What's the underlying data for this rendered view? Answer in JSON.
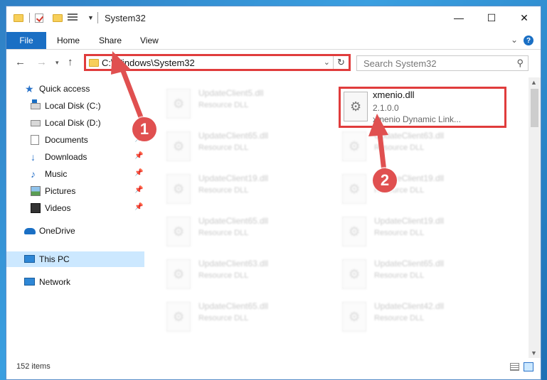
{
  "window": {
    "title": "System32",
    "controls": {
      "minimize": "—",
      "maximize": "☐",
      "close": "✕"
    }
  },
  "ribbon": {
    "tabs": [
      "File",
      "Home",
      "Share",
      "View"
    ],
    "help": "?"
  },
  "navigation": {
    "address": "C:\\Windows\\System32",
    "search_placeholder": "Search System32"
  },
  "sidebar": {
    "items": [
      {
        "label": "Quick access",
        "icon": "quick-access-icon"
      },
      {
        "label": "Local Disk (C:)",
        "icon": "local-disk-icon"
      },
      {
        "label": "Local Disk (D:)",
        "icon": "local-disk-icon"
      },
      {
        "label": "Documents",
        "icon": "documents-icon",
        "pinned": true
      },
      {
        "label": "Downloads",
        "icon": "downloads-icon",
        "pinned": true
      },
      {
        "label": "Music",
        "icon": "music-icon",
        "pinned": true
      },
      {
        "label": "Pictures",
        "icon": "pictures-icon",
        "pinned": true
      },
      {
        "label": "Videos",
        "icon": "videos-icon",
        "pinned": true
      },
      {
        "label": "OneDrive",
        "icon": "onedrive-icon"
      },
      {
        "label": "This PC",
        "icon": "this-pc-icon",
        "selected": true
      },
      {
        "label": "Network",
        "icon": "network-icon"
      }
    ]
  },
  "files": {
    "highlighted": {
      "name": "xmenio.dll",
      "version": "2.1.0.0",
      "description": "xmenio Dynamic Link..."
    },
    "blurred": [
      {
        "name": "UpdateClient5.dll",
        "type": "Resource DLL"
      },
      {
        "name": "UpdateClient65.dll",
        "type": "Resource DLL"
      },
      {
        "name": "UpdateClient63.dll",
        "type": "Resource DLL"
      },
      {
        "name": "UpdateClient19.dll",
        "type": "Resource DLL"
      },
      {
        "name": "UpdateClient19.dll",
        "type": "Resource DLL"
      },
      {
        "name": "UpdateClient65.dll",
        "type": "Resource DLL"
      },
      {
        "name": "UpdateClient19.dll",
        "type": "Resource DLL"
      },
      {
        "name": "UpdateClient63.dll",
        "type": "Resource DLL"
      },
      {
        "name": "UpdateClient65.dll",
        "type": "Resource DLL"
      },
      {
        "name": "UpdateClient65.dll",
        "type": "Resource DLL"
      },
      {
        "name": "UpdateClient42.dll",
        "type": "Resource DLL"
      }
    ]
  },
  "status": {
    "item_count": "152 items"
  },
  "annotations": {
    "callout_1": "1",
    "callout_2": "2",
    "highlight_color": "#e03c3c"
  }
}
